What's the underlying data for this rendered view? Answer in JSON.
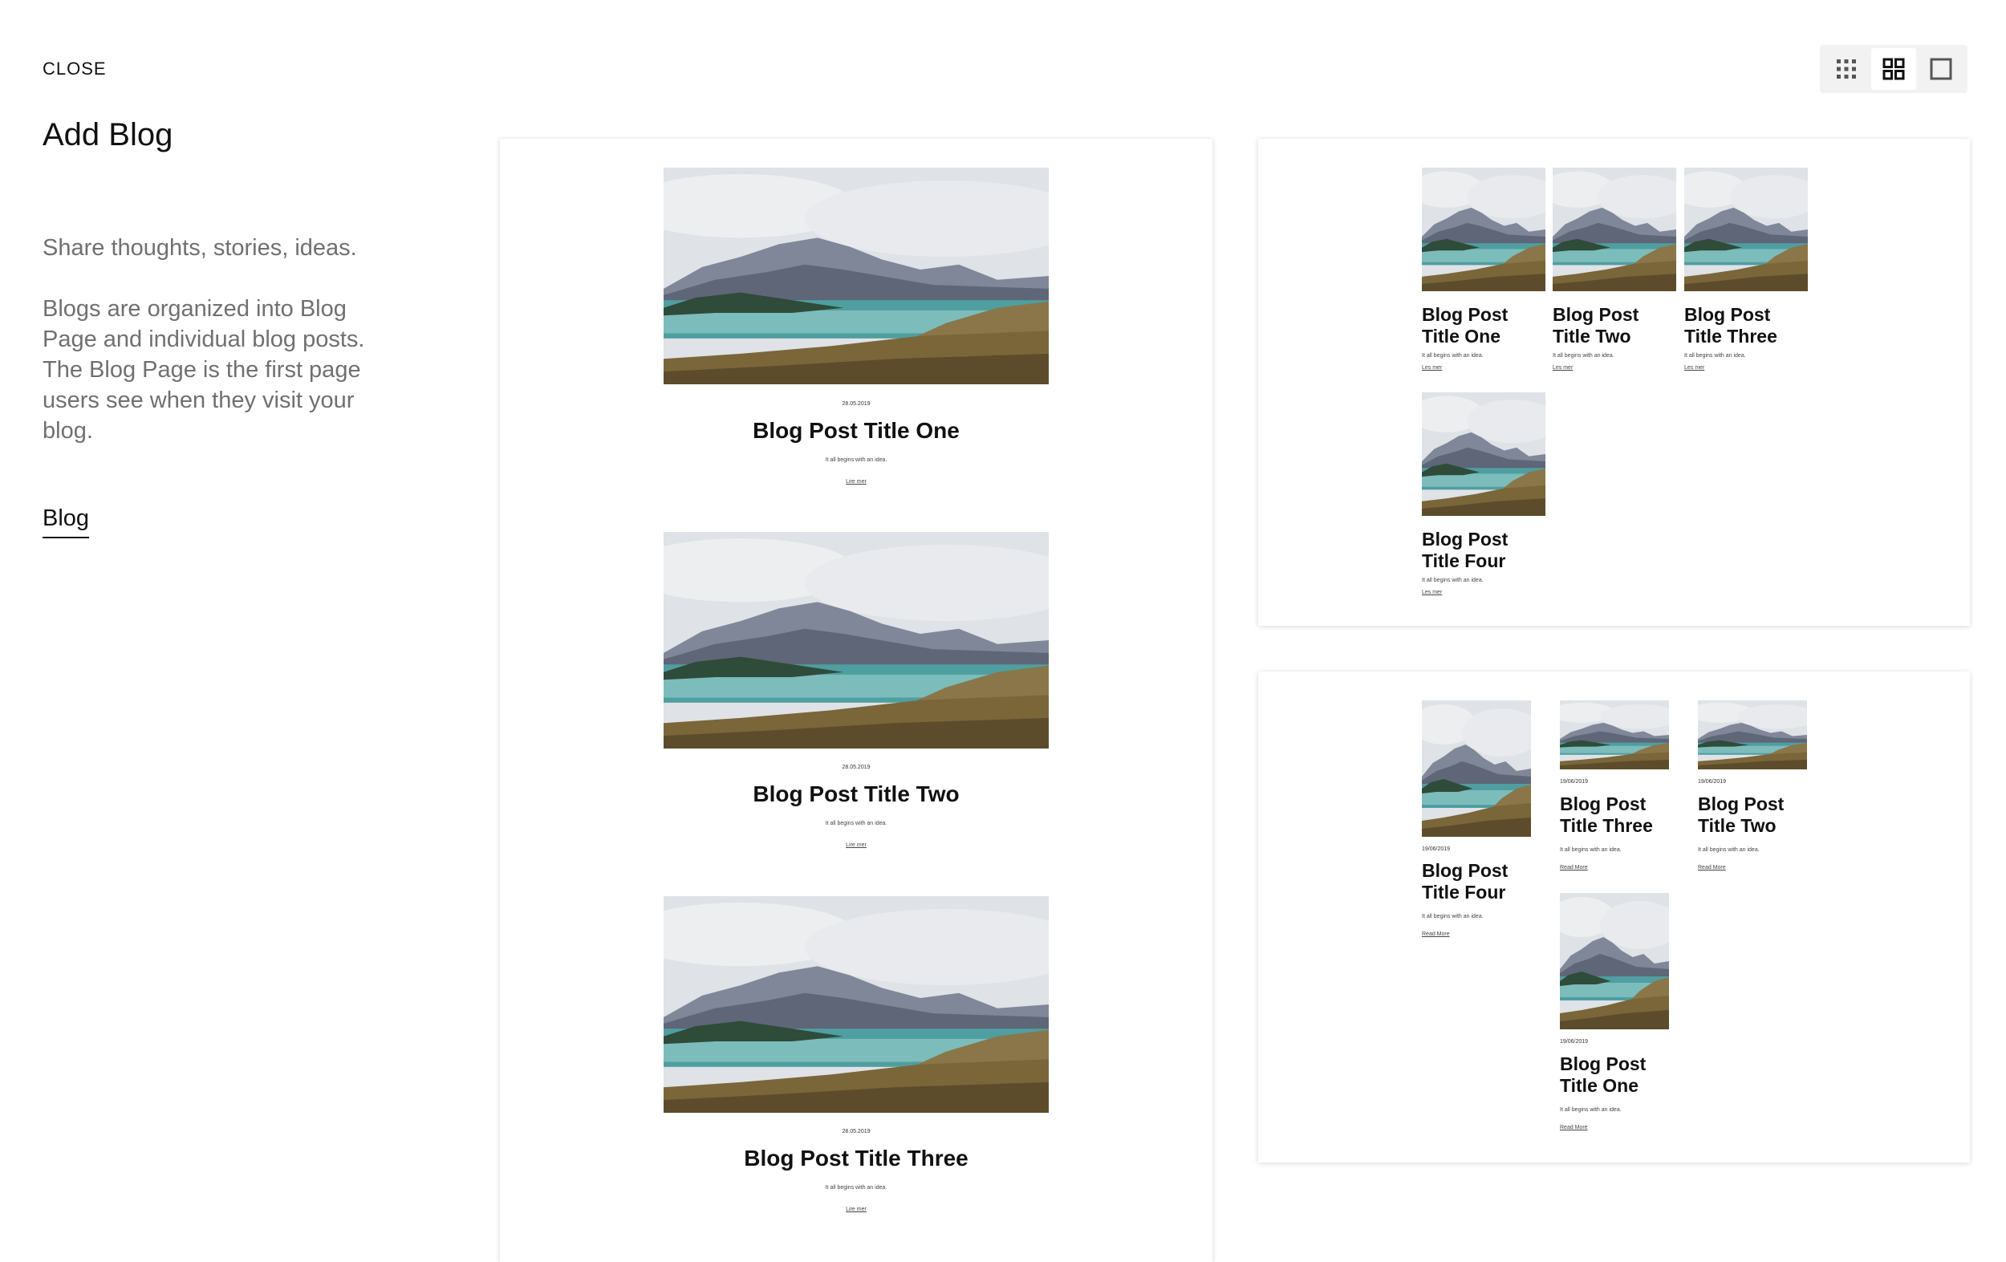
{
  "sidebar": {
    "close_label": "CLOSE",
    "title": "Add Blog",
    "tagline": "Share thoughts, stories, ideas.",
    "description": "Blogs are organized into Blog Page and individual blog posts. The Blog Page is the first page users see when they visit your blog.",
    "blog_link": "Blog"
  },
  "view_toggle": {
    "options": [
      {
        "name": "small-grid",
        "icon": "small-grid-icon",
        "active": false
      },
      {
        "name": "large-grid",
        "icon": "large-grid-icon",
        "active": true
      },
      {
        "name": "single",
        "icon": "single-square-icon",
        "active": false
      }
    ]
  },
  "templates": {
    "list": {
      "posts": [
        {
          "date": "28.05.2019",
          "title": "Blog Post Title One",
          "excerpt": "It all begins with an idea.",
          "more": "Lire mer"
        },
        {
          "date": "28.05.2019",
          "title": "Blog Post Title Two",
          "excerpt": "It all begins with an idea.",
          "more": "Lire mer"
        },
        {
          "date": "28.05.2019",
          "title": "Blog Post Title Three",
          "excerpt": "It all begins with an idea.",
          "more": "Lire mer"
        }
      ]
    },
    "grid": {
      "posts": [
        {
          "title": "Blog Post Title One",
          "excerpt": "It all begins with an idea.",
          "more": "Les mer"
        },
        {
          "title": "Blog Post Title Two",
          "excerpt": "It all begins with an idea.",
          "more": "Les mer"
        },
        {
          "title": "Blog Post Title Three",
          "excerpt": "It all begins with an idea.",
          "more": "Les mer"
        },
        {
          "title": "Blog Post Title Four",
          "excerpt": "It all begins with an idea.",
          "more": "Les mer"
        }
      ]
    },
    "masonry": {
      "posts": [
        {
          "date": "19/06/2019",
          "title": "Blog Post Title Four",
          "excerpt": "It all begins with an idea.",
          "more": "Read More"
        },
        {
          "date": "19/06/2019",
          "title": "Blog Post Title Three",
          "excerpt": "It all begins with an idea.",
          "more": "Read More"
        },
        {
          "date": "19/06/2019",
          "title": "Blog Post Title Two",
          "excerpt": "It all begins with an idea.",
          "more": "Read More"
        },
        {
          "date": "19/06/2019",
          "title": "Blog Post Title One",
          "excerpt": "It all begins with an idea.",
          "more": "Read More"
        }
      ]
    }
  }
}
